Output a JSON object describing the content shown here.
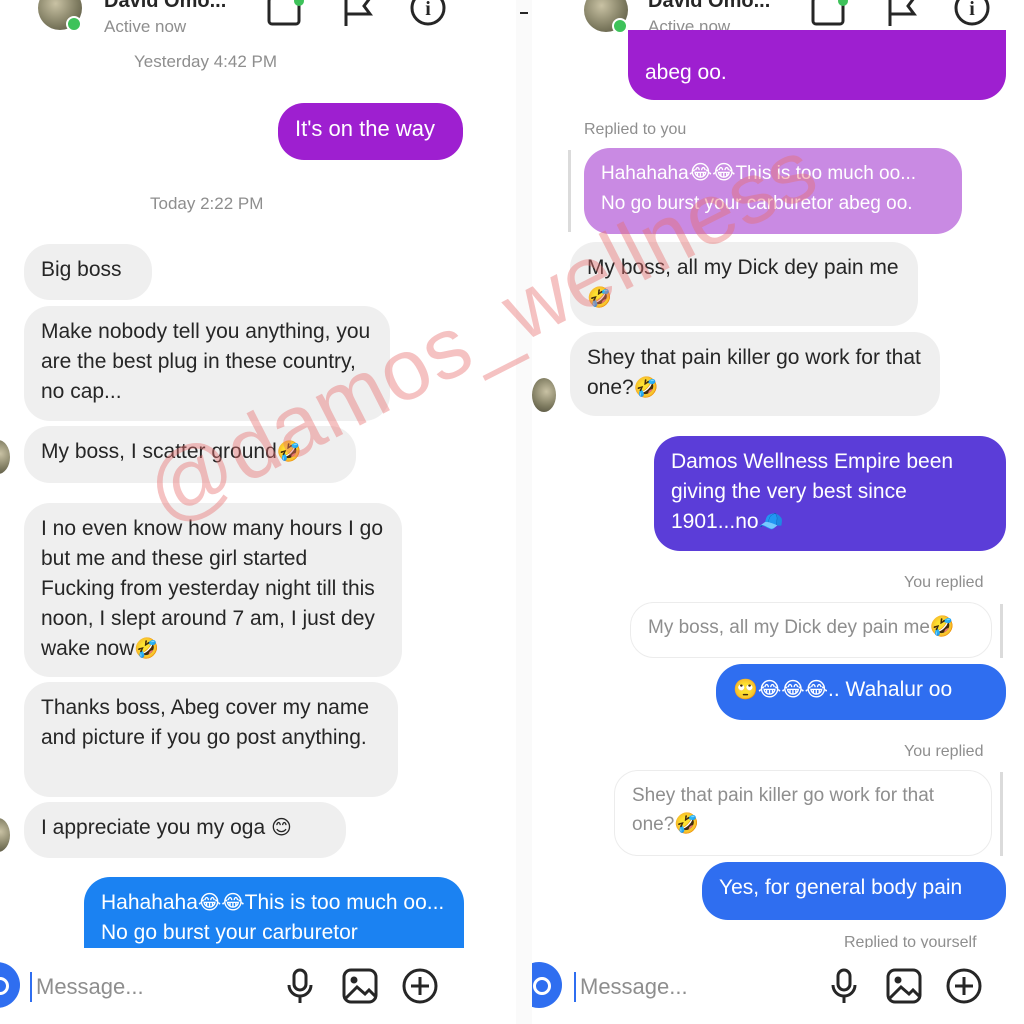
{
  "left": {
    "header": {
      "name": "David Omo...",
      "status": "Active now"
    },
    "timestamps": {
      "yesterday": "Yesterday 4:42 PM",
      "today": "Today 2:22 PM"
    },
    "messages": {
      "m1": "It's on the way",
      "m2": "Big boss",
      "m3": "Make nobody tell you anything, you are the best plug in these country, no cap...",
      "m4": "My boss, I scatter ground",
      "m5": "I no even know how many hours I go but me and these girl started Fucking from yesterday night till this noon, I slept around 7 am, I just dey wake now",
      "m6": "Thanks boss, Abeg cover my name and picture if you go post anything.",
      "m7": "I appreciate you my oga",
      "m8a": "Hahahaha",
      "m8b": "This is too much oo... No go burst your carburetor"
    },
    "input": {
      "placeholder": "Message..."
    }
  },
  "right": {
    "header": {
      "name": "David Omo...",
      "status": "Active now"
    },
    "messages": {
      "top": "abeg oo.",
      "replied_to_you": "Replied to you",
      "reply_a": "Hahahaha",
      "reply_b": "This is too much oo... No go burst your carburetor abeg oo.",
      "r1": "My boss, all my Dick dey pain me",
      "r2": "Shey that pain killer go work for that one?",
      "r3": "Damos Wellness Empire been giving the very best since 1901...no",
      "you_replied_1": "You replied",
      "quote1": "My boss, all my Dick dey pain me",
      "r4": ".. Wahalur oo",
      "you_replied_2": "You replied",
      "quote2": "Shey that pain killer go work for that one?",
      "r5": "Yes, for general body pain",
      "partial": "Replied to yourself"
    },
    "input": {
      "placeholder": "Message..."
    }
  },
  "watermark": "@damos_wellness",
  "emoji": {
    "rofl": "🤣",
    "joy": "😂",
    "smile": "😊",
    "eyeroll": "🙄",
    "cap": "🧢"
  },
  "colors": {
    "purple": "#9e1fd0",
    "indigo": "#5b3dd8",
    "blue": "#2f6ef0",
    "incoming": "#efefef",
    "online": "#3ec25a"
  },
  "icons": [
    "video-call-icon",
    "flag-icon",
    "info-icon",
    "camera-icon",
    "microphone-icon",
    "image-icon",
    "add-circle-icon"
  ]
}
